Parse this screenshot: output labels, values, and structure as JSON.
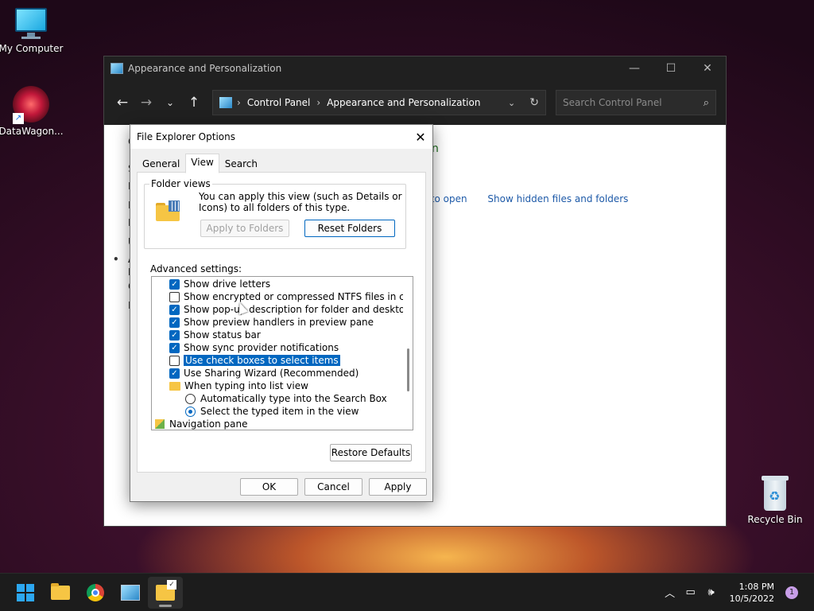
{
  "desktop": {
    "my_computer": "My Computer",
    "datawagon": "DataWagon...",
    "recycle_bin": "Recycle Bin"
  },
  "control_panel": {
    "title": "Appearance and Personalization",
    "breadcrumb": [
      "Control Panel",
      "Appearance and Personalization"
    ],
    "search_placeholder": "Search Control Panel",
    "left_letters": [
      "C",
      "S",
      "N",
      "H",
      "P",
      "U",
      "•",
      "A",
      "F",
      "C",
      "E"
    ],
    "heading_fragment": "n",
    "links": [
      "k to open",
      "Show hidden files and folders"
    ]
  },
  "dialog": {
    "title": "File Explorer Options",
    "tabs": [
      "General",
      "View",
      "Search"
    ],
    "active_tab": "View",
    "folder_views": {
      "label": "Folder views",
      "text": "You can apply this view (such as Details or Icons) to all folders of this type.",
      "apply_button": "Apply to Folders",
      "reset_button": "Reset Folders"
    },
    "advanced_label": "Advanced settings:",
    "advanced_items": [
      {
        "type": "check",
        "checked": true,
        "label": "Show drive letters"
      },
      {
        "type": "check",
        "checked": false,
        "label": "Show encrypted or compressed NTFS files in color"
      },
      {
        "type": "check",
        "checked": true,
        "label": "Show pop-up description for folder and desktop items"
      },
      {
        "type": "check",
        "checked": true,
        "label": "Show preview handlers in preview pane"
      },
      {
        "type": "check",
        "checked": true,
        "label": "Show status bar"
      },
      {
        "type": "check",
        "checked": true,
        "label": "Show sync provider notifications"
      },
      {
        "type": "check",
        "checked": false,
        "label": "Use check boxes to select items",
        "selected": true
      },
      {
        "type": "check",
        "checked": true,
        "label": "Use Sharing Wizard (Recommended)"
      },
      {
        "type": "folder",
        "label": "When typing into list view"
      },
      {
        "type": "radio",
        "checked": false,
        "label": "Automatically type into the Search Box"
      },
      {
        "type": "radio",
        "checked": true,
        "label": "Select the typed item in the view"
      },
      {
        "type": "nav",
        "label": "Navigation pane"
      }
    ],
    "restore_button": "Restore Defaults",
    "ok_button": "OK",
    "cancel_button": "Cancel",
    "apply_button": "Apply"
  },
  "taskbar": {
    "time": "1:08 PM",
    "date": "10/5/2022",
    "notification_count": "1"
  },
  "colors": {
    "accent": "#0067c0",
    "folder": "#f6c544"
  }
}
